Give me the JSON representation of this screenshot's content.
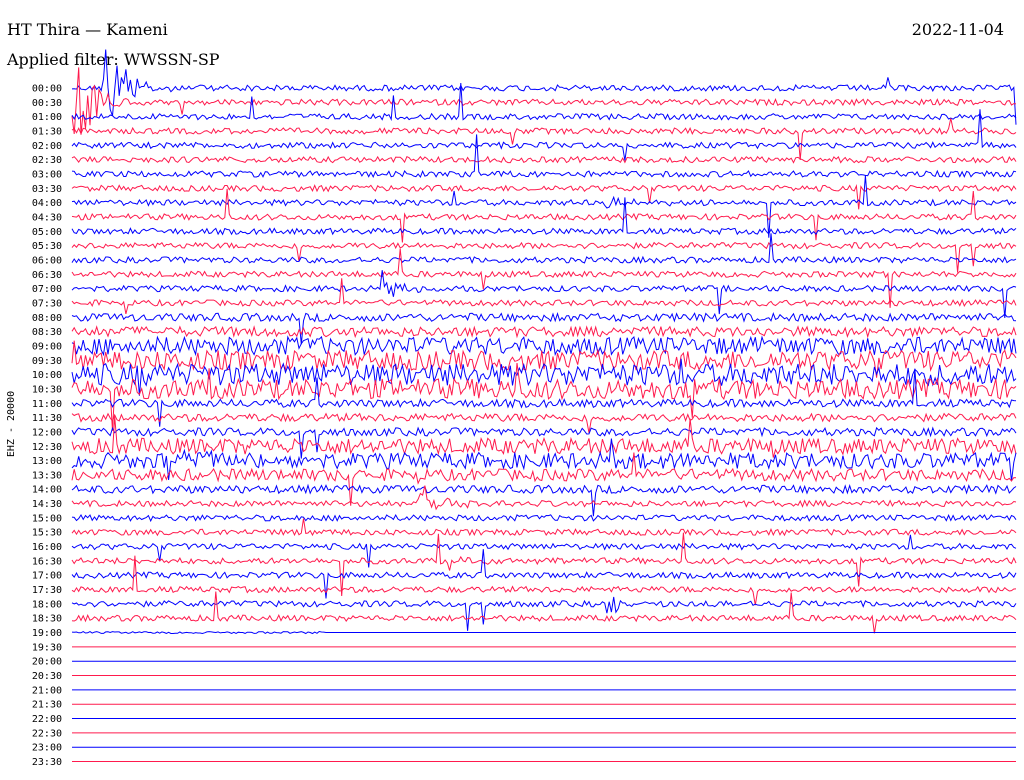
{
  "header": {
    "station": "HT Thira — Kameni",
    "date": "2022-11-04",
    "filter": "Applied filter: WWSSN-SP"
  },
  "chart_data": {
    "type": "line",
    "title": "HT Thira — Kameni",
    "date": "2022-11-04",
    "filter": "WWSSN-SP",
    "ylabel": "EHZ - 20000",
    "xlim_minutes": [
      0,
      30
    ],
    "row_labels": [
      "00:00",
      "00:30",
      "01:00",
      "01:30",
      "02:00",
      "02:30",
      "03:00",
      "03:30",
      "04:00",
      "04:30",
      "05:00",
      "05:30",
      "06:00",
      "06:30",
      "07:00",
      "07:30",
      "08:00",
      "08:30",
      "09:00",
      "09:30",
      "10:00",
      "10:30",
      "11:00",
      "11:30",
      "12:00",
      "12:30",
      "13:00",
      "13:30",
      "14:00",
      "14:30",
      "15:00",
      "15:30",
      "16:00",
      "16:30",
      "17:00",
      "17:30",
      "18:00",
      "18:30",
      "19:00",
      "19:30",
      "20:00",
      "20:30",
      "21:00",
      "21:30",
      "22:00",
      "22:30",
      "23:00",
      "23:30"
    ],
    "series": [
      {
        "color": "#0000ff"
      },
      {
        "color": "#ff1a4d"
      }
    ],
    "noise_level": [
      3,
      3,
      3,
      3,
      3,
      3,
      3,
      3,
      3,
      3,
      3,
      3,
      3,
      3,
      3,
      3,
      4,
      5,
      9,
      10,
      11,
      10,
      4,
      4,
      4,
      8,
      8,
      6,
      4,
      3,
      3,
      3,
      3,
      3,
      3,
      3,
      3,
      3,
      1,
      0,
      0,
      0,
      0,
      0,
      0,
      0,
      0,
      0
    ],
    "data_end": "19:08",
    "events": [
      {
        "time": "00:01",
        "amplitude": "large"
      },
      {
        "time": "00:30",
        "amplitude": "large"
      },
      {
        "time": "13:03",
        "amplitude": "medium"
      },
      {
        "time": "14:41",
        "amplitude": "medium"
      },
      {
        "time": "07:10",
        "amplitude": "small"
      },
      {
        "time": "16:42",
        "amplitude": "small"
      },
      {
        "time": "18:17",
        "amplitude": "small"
      },
      {
        "time": "04:17",
        "amplitude": "small"
      }
    ]
  }
}
